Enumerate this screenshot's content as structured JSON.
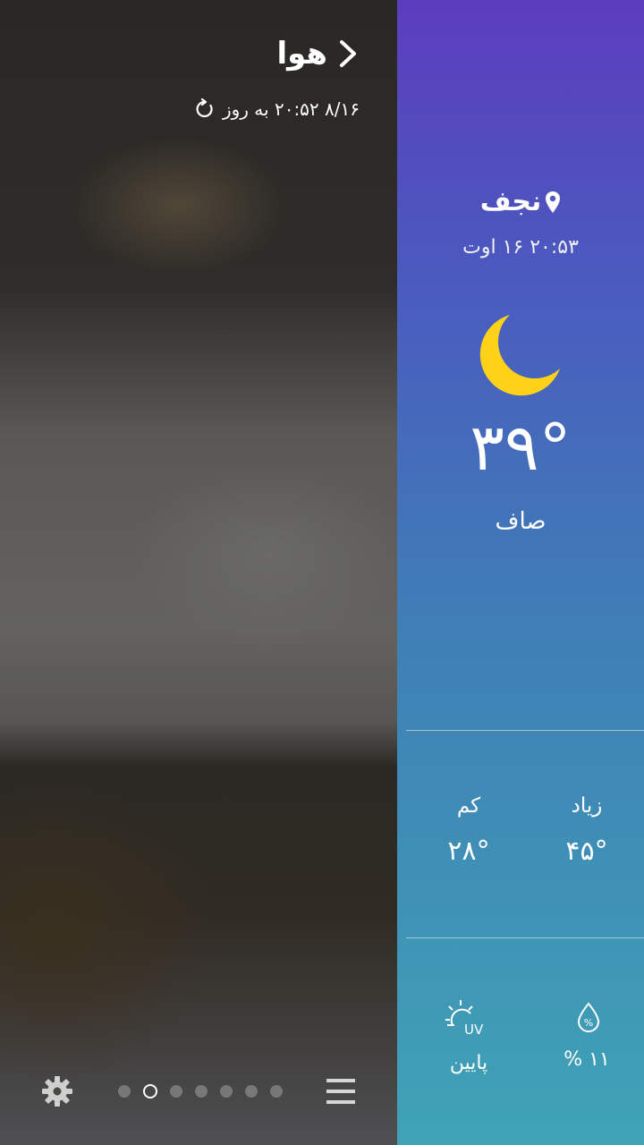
{
  "header": {
    "title": "هوا",
    "updated_text": "۸/۱۶ ۲۰:۵۲ به روز"
  },
  "bottom_bar": {
    "page_count": 7,
    "active_page_index": 1
  },
  "weather": {
    "city": "نجف",
    "datetime": "۲۰:۵۳ ۱۶ اوت",
    "temperature": "۳۹°",
    "condition": "صاف",
    "high_label": "زیاد",
    "high_value": "۴۵°",
    "low_label": "کم",
    "low_value": "۲۸°",
    "humidity_value": "۱۱ %",
    "uv_value": "پایین",
    "uv_icon_text": "UV"
  },
  "colors": {
    "gradient_top": "#5c3dbd",
    "gradient_bottom": "#3fa3b6",
    "moon": "#ffd21a"
  },
  "icons": [
    "chevron-right-icon",
    "refresh-icon",
    "settings-gear-icon",
    "hamburger-menu-icon",
    "location-pin-icon",
    "moon-icon",
    "uv-sun-icon",
    "humidity-drop-icon"
  ]
}
